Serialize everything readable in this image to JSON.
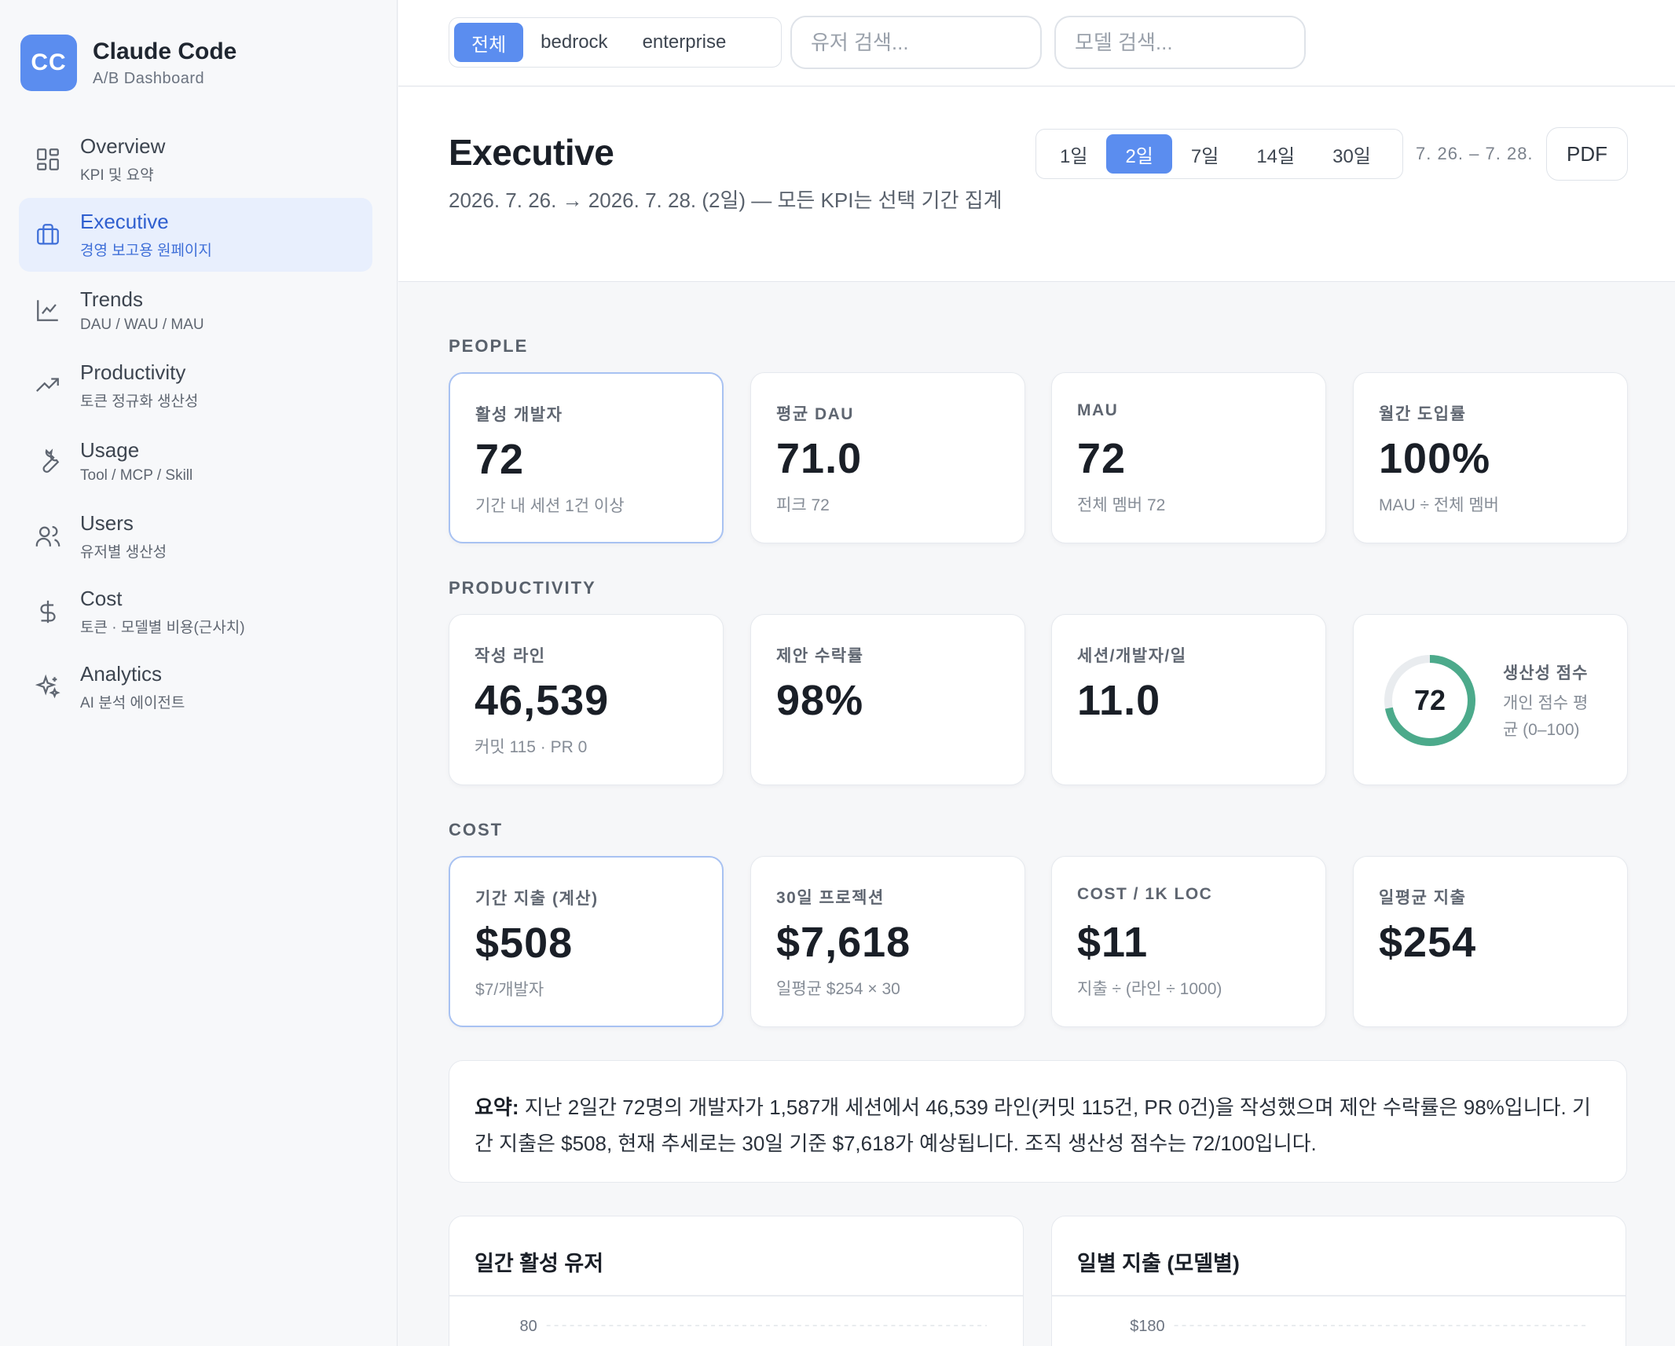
{
  "brand": {
    "logo": "CC",
    "title": "Claude Code",
    "subtitle": "A/B Dashboard"
  },
  "sidebar": {
    "items": [
      {
        "label": "Overview",
        "sub": "KPI 및 요약",
        "icon": "grid-icon"
      },
      {
        "label": "Executive",
        "sub": "경영 보고용 원페이지",
        "icon": "briefcase-icon",
        "active": true
      },
      {
        "label": "Trends",
        "sub": "DAU / WAU / MAU",
        "icon": "line-chart-icon"
      },
      {
        "label": "Productivity",
        "sub": "토큰 정규화 생산성",
        "icon": "trending-up-icon"
      },
      {
        "label": "Usage",
        "sub": "Tool / MCP / Skill",
        "icon": "wrench-icon"
      },
      {
        "label": "Users",
        "sub": "유저별 생산성",
        "icon": "users-icon"
      },
      {
        "label": "Cost",
        "sub": "토큰 · 모델별 비용(근사치)",
        "icon": "dollar-icon"
      },
      {
        "label": "Analytics",
        "sub": "AI 분석 에이전트",
        "icon": "sparkles-icon"
      }
    ]
  },
  "topbar": {
    "segments": [
      "전체",
      "bedrock",
      "enterprise"
    ],
    "selected_segment": "전체",
    "user_search_placeholder": "유저 검색...",
    "model_search_placeholder": "모델 검색..."
  },
  "header": {
    "title": "Executive",
    "subtitle": "2026. 7. 26. → 2026. 7. 28. (2일) — 모든 KPI는 선택 기간 집계",
    "ranges": [
      "1일",
      "2일",
      "7일",
      "14일",
      "30일"
    ],
    "selected_range": "2일",
    "range_text": "7. 26. – 7. 28.",
    "pdf_label": "PDF"
  },
  "sections": {
    "people": {
      "label": "PEOPLE",
      "cards": [
        {
          "label": "활성 개발자",
          "value": "72",
          "sub": "기간 내 세션 1건 이상"
        },
        {
          "label": "평균 DAU",
          "value": "71.0",
          "sub": "피크 72"
        },
        {
          "label": "MAU",
          "value": "72",
          "sub": "전체 멤버 72"
        },
        {
          "label": "월간 도입률",
          "value": "100%",
          "sub": "MAU ÷ 전체 멤버"
        }
      ]
    },
    "productivity": {
      "label": "PRODUCTIVITY",
      "cards": [
        {
          "label": "작성 라인",
          "value": "46,539",
          "sub": "커밋 115 · PR 0"
        },
        {
          "label": "제안 수락률",
          "value": "98%",
          "sub": ""
        },
        {
          "label": "세션/개발자/일",
          "value": "11.0",
          "sub": ""
        }
      ],
      "score": {
        "value": "72",
        "fraction": 0.72,
        "title": "생산성 점수",
        "desc": "개인 점수 평균 (0–100)",
        "color": "#4caa8b"
      }
    },
    "cost": {
      "label": "COST",
      "cards": [
        {
          "label": "기간 지출 (계산)",
          "value": "$508",
          "sub": "$7/개발자"
        },
        {
          "label": "30일 프로젝션",
          "value": "$7,618",
          "sub": "일평균 $254 × 30"
        },
        {
          "label": "COST / 1K LOC",
          "value": "$11",
          "sub": "지출 ÷ (라인 ÷ 1000)"
        },
        {
          "label": "일평균 지출",
          "value": "$254",
          "sub": ""
        }
      ]
    }
  },
  "summary": {
    "prefix": "요약:",
    "text": " 지난 2일간 72명의 개발자가 1,587개 세션에서 46,539 라인(커밋 115건, PR 0건)을 작성했으며 제안 수락률은 98%입니다. 기간 지출은 $508, 현재 추세로는 30일 기준 $7,618가 예상됩니다. 조직 생산성 점수는 72/100입니다."
  },
  "charts": {
    "dau": {
      "title": "일간 활성 유저",
      "first_tick": "80"
    },
    "spend": {
      "title": "일별 지출 (모델별)",
      "first_tick": "$180"
    }
  },
  "colors": {
    "accent": "#5b8def",
    "score": "#4caa8b"
  }
}
